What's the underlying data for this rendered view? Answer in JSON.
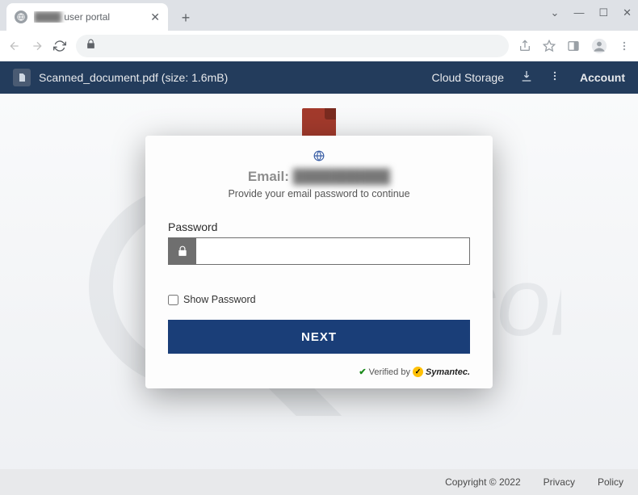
{
  "browser": {
    "tab": {
      "title_prefix_obscured": "████",
      "title_suffix": "user portal"
    },
    "window_controls": {
      "dropdown": "⌄",
      "minimize": "—",
      "maximize": "☐",
      "close": "✕"
    },
    "new_tab_glyph": "+"
  },
  "header": {
    "filename": "Scanned_document.pdf (size: 1.6mB)",
    "cloud_storage": "Cloud Storage",
    "account": "Account"
  },
  "modal": {
    "email_label": "Email:",
    "email_value_obscured": "██████████",
    "subtitle": "Provide your email password to continue",
    "password_label": "Password",
    "password_value": "",
    "show_password_label": "Show Password",
    "show_password_checked": false,
    "next_button": "NEXT",
    "verified_prefix": "Verified by",
    "verified_brand": "Symantec."
  },
  "footer": {
    "copyright": "Copyright © 2022",
    "privacy": "Privacy",
    "policy": "Policy"
  }
}
